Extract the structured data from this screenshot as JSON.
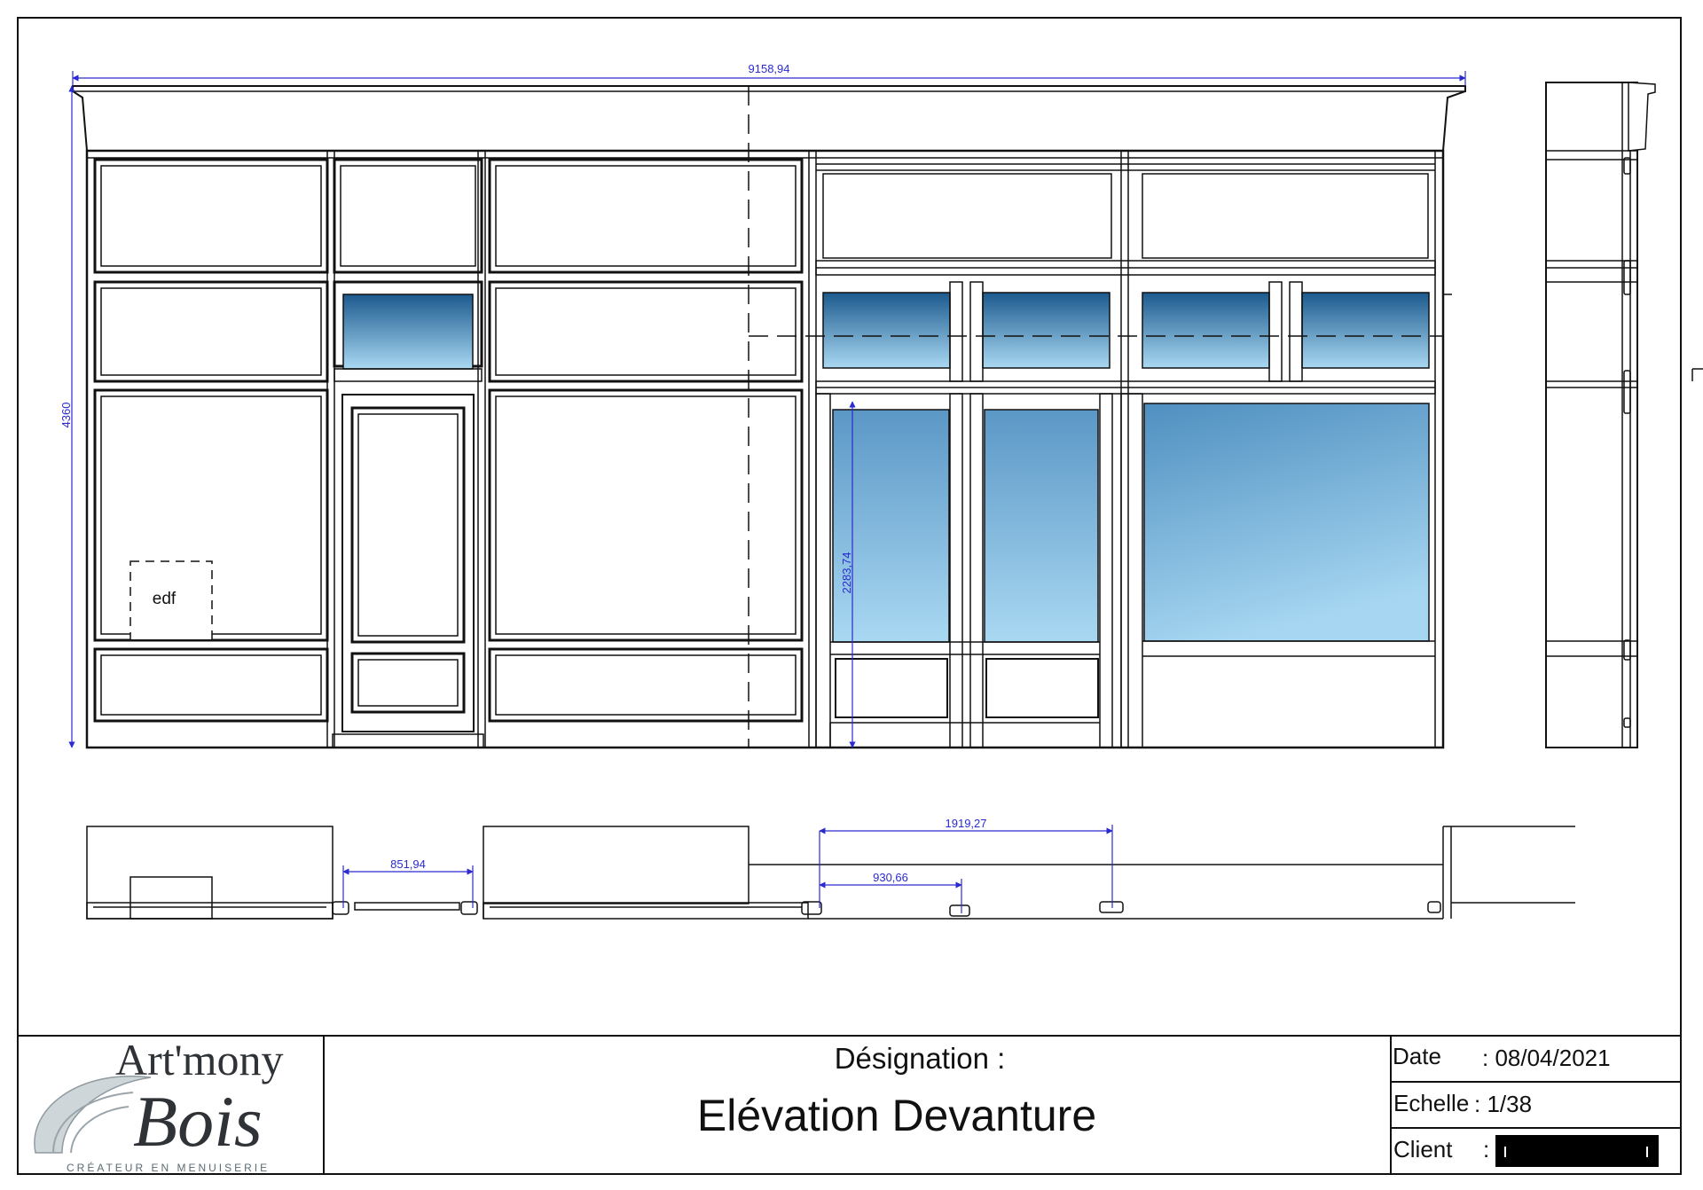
{
  "drawing": {
    "dimensions": {
      "overall_width": "9158,94",
      "overall_height": "4360",
      "glazing_height": "2283,74",
      "door_width": "851,94",
      "span_a": "930,66",
      "span_b": "1919,27"
    },
    "meter_box_label": "edf"
  },
  "title_block": {
    "logo": {
      "line1": "Art'mony",
      "line2": "Bois",
      "tagline": "CRÉATEUR EN MENUISERIE"
    },
    "designation_label": "Désignation :",
    "designation_value": "Elévation Devanture",
    "date_label": "Date",
    "date_value": ": 08/04/2021",
    "scale_label": "Echelle",
    "scale_value": ": 1/38",
    "client_label": "Client",
    "client_sep": ":",
    "client_value": ""
  },
  "colors": {
    "line": "#111111",
    "dimension": "#2a2acf",
    "glass_dark": "#1f5f93",
    "glass_light": "#a8d6f0"
  }
}
